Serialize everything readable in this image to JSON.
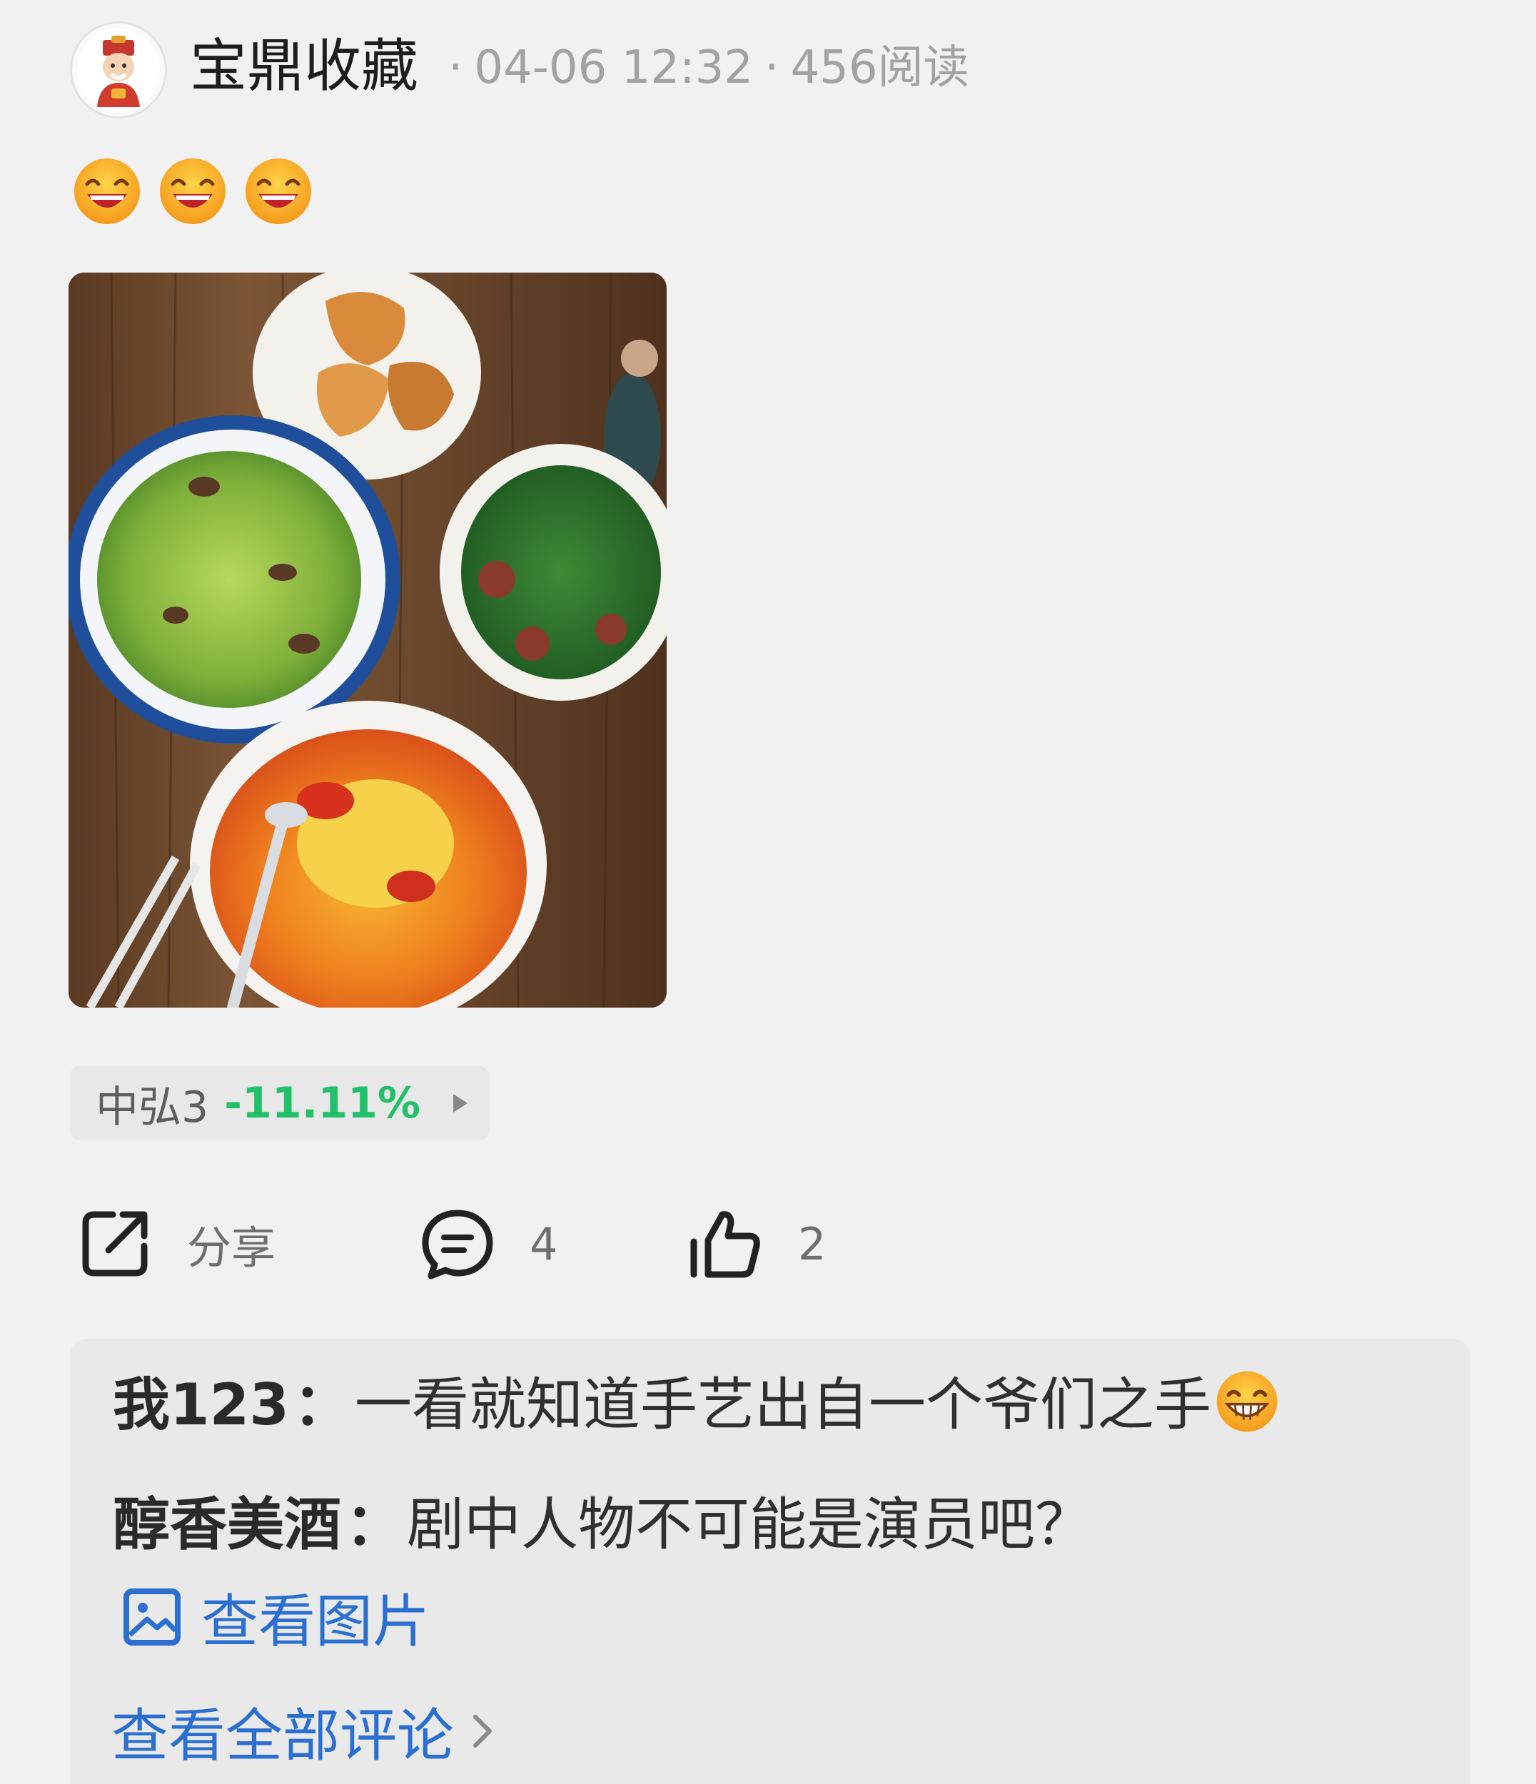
{
  "post": {
    "author": "宝鼎收藏",
    "date": "04-06 12:32",
    "reads": "456阅读",
    "separator": "·",
    "emojis": [
      "grin-emoji",
      "grin-emoji",
      "grin-emoji"
    ]
  },
  "stock": {
    "name": "中弘3",
    "change": "-11.11%",
    "change_color": "#21c16b"
  },
  "actions": {
    "share_label": "分享",
    "comment_count": "4",
    "like_count": "2"
  },
  "comments": [
    {
      "user": "我123",
      "colon": "：",
      "text": "一看就知道手艺出自一个爷们之手"
    },
    {
      "user": "醇香美酒",
      "colon": "：",
      "text": "剧中人物不可能是演员吧？"
    }
  ],
  "links": {
    "view_image": "查看图片",
    "view_all_comments": "查看全部评论",
    "link_color": "#2b6fd1"
  }
}
